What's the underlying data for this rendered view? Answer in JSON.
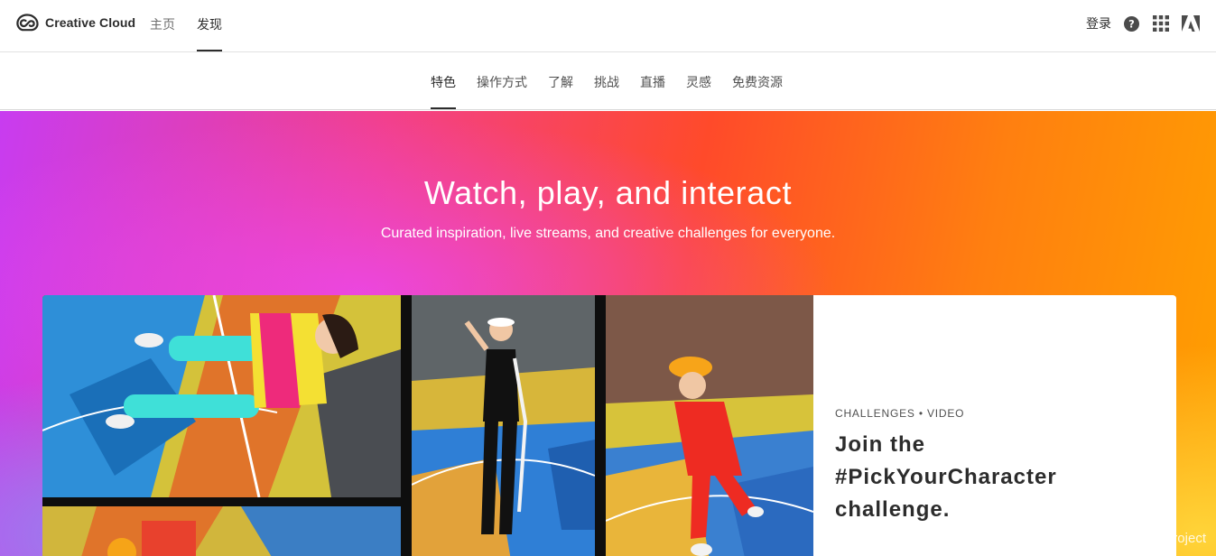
{
  "header": {
    "brand": "Creative Cloud",
    "nav": [
      {
        "label": "主页",
        "active": false
      },
      {
        "label": "发现",
        "active": true
      }
    ],
    "signin_label": "登录",
    "icons": [
      "help-icon",
      "apps-grid-icon",
      "adobe-logo-icon"
    ]
  },
  "subnav": {
    "items": [
      {
        "label": "特色",
        "active": true
      },
      {
        "label": "操作方式",
        "active": false
      },
      {
        "label": "了解",
        "active": false
      },
      {
        "label": "挑战",
        "active": false
      },
      {
        "label": "直播",
        "active": false
      },
      {
        "label": "灵感",
        "active": false
      },
      {
        "label": "免费资源",
        "active": false
      }
    ]
  },
  "hero": {
    "title": "Watch, play, and interact",
    "subtitle": "Curated inspiration, live streams, and creative challenges for everyone."
  },
  "feature_card": {
    "category": "CHALLENGES • VIDEO",
    "title": "Join the #PickYourCharacter challenge."
  },
  "watermark": "https://blog.csdn.net/ResumeProject",
  "colors": {
    "gradient": [
      "#c83cf0",
      "#f2408c",
      "#ff4a2a",
      "#ff7f10",
      "#ffa000"
    ],
    "text_dark": "#2c2c2c"
  }
}
